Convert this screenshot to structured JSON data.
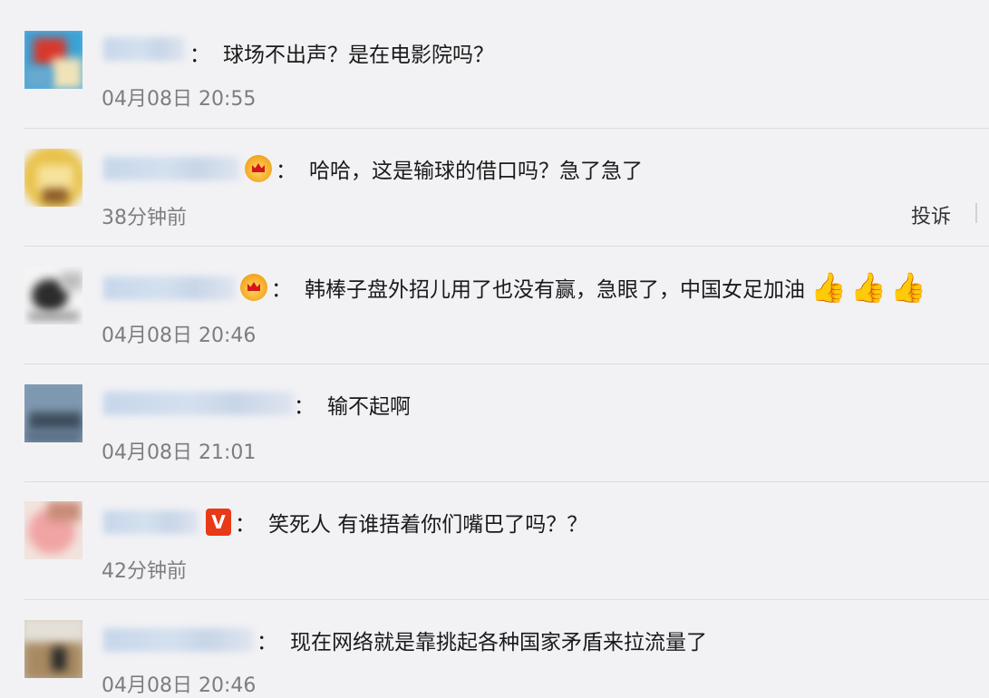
{
  "comments": [
    {
      "text": "球场不出声？是在电影院吗？",
      "time": "04月08日 20:55",
      "badge": "none"
    },
    {
      "text": "哈哈，这是输球的借口吗？急了急了",
      "time": "38分钟前",
      "badge": "crown",
      "report_label": "投诉"
    },
    {
      "text": "韩棒子盘外招儿用了也没有赢，急眼了，中国女足加油",
      "time": "04月08日 20:46",
      "badge": "crown",
      "emoji": "thumbs-up x3"
    },
    {
      "text": "输不起啊",
      "time": "04月08日 21:01",
      "badge": "none"
    },
    {
      "text": "笑死人 有谁捂着你们嘴巴了吗？？",
      "time": "42分钟前",
      "badge": "vip",
      "badge_letter": "V"
    },
    {
      "text": "现在网络就是靠挑起各种国家矛盾来拉流量了",
      "time": "04月08日 20:46",
      "badge": "none"
    }
  ],
  "separator": "：",
  "thumb_glyph": "👍",
  "colors": {
    "background": "#f2f2f5",
    "text": "#1a1a1a",
    "time": "#7d7d7d",
    "divider": "#dcdcdf",
    "vip": "#e83a17"
  }
}
